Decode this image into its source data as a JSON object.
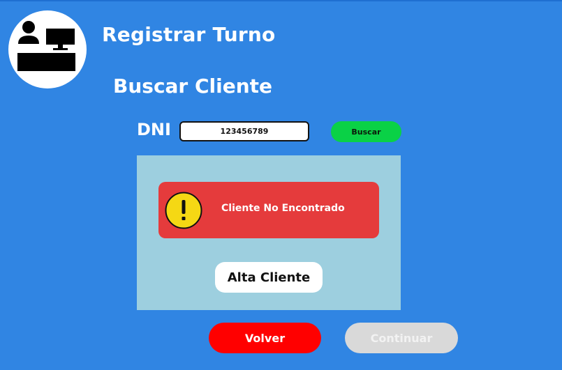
{
  "header": {
    "logo_icon": "receptionist-desk-icon",
    "title": "Registrar Turno"
  },
  "search": {
    "section_title": "Buscar Cliente",
    "dni_label": "DNI",
    "dni_value": "123456789",
    "buscar_label": "Buscar"
  },
  "result": {
    "alert_icon": "warning-icon",
    "alert_text": "Cliente No Encontrado",
    "alta_label": "Alta Cliente"
  },
  "footer": {
    "volver_label": "Volver",
    "continuar_label": "Continuar",
    "continuar_enabled": false
  },
  "colors": {
    "background": "#3085e3",
    "panel": "#9dcfdf",
    "alert": "#e53b3c",
    "buscar": "#0ad146",
    "volver": "#ff0000",
    "continuar_disabled": "#d9d9d9",
    "warning_yellow": "#f5d814"
  }
}
